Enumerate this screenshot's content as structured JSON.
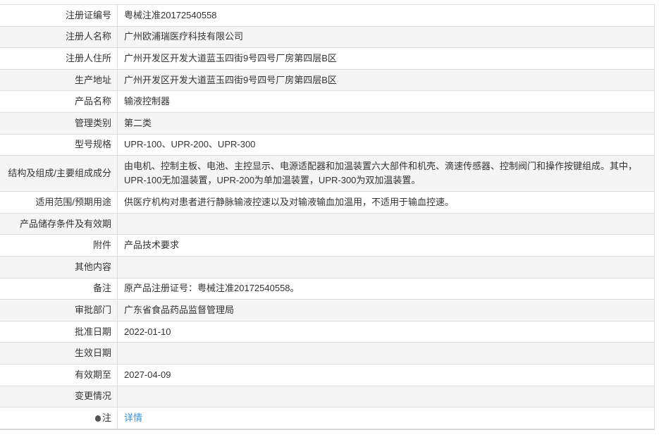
{
  "rows": [
    {
      "label": "注册证编号",
      "value": "粤械注准20172540558"
    },
    {
      "label": "注册人名称",
      "value": "广州欧浦瑞医疗科技有限公司"
    },
    {
      "label": "注册人住所",
      "value": "广州开发区开发大道蓝玉四街9号四号厂房第四层B区"
    },
    {
      "label": "生产地址",
      "value": "广州开发区开发大道蓝玉四街9号四号厂房第四层B区"
    },
    {
      "label": "产品名称",
      "value": "输液控制器"
    },
    {
      "label": "管理类别",
      "value": "第二类"
    },
    {
      "label": "型号规格",
      "value": "UPR-100、UPR-200、UPR-300"
    },
    {
      "label": "结构及组成/主要组成成分",
      "value": "由电机、控制主板、电池、主控显示、电源适配器和加温装置六大部件和机壳、滴速传感器、控制阀门和操作按键组成。其中，UPR-100无加温装置，UPR-200为单加温装置，UPR-300为双加温装置。"
    },
    {
      "label": "适用范围/预期用途",
      "value": "供医疗机构对患者进行静脉输液控速以及对输液输血加温用，不适用于输血控速。"
    },
    {
      "label": "产品储存条件及有效期",
      "value": ""
    },
    {
      "label": "附件",
      "value": "产品技术要求"
    },
    {
      "label": "其他内容",
      "value": ""
    },
    {
      "label": "备注",
      "value": "原产品注册证号：粤械注准20172540558。"
    },
    {
      "label": "审批部门",
      "value": "广东省食品药品监督管理局"
    },
    {
      "label": "批准日期",
      "value": "2022-01-10"
    },
    {
      "label": "生效日期",
      "value": ""
    },
    {
      "label": "有效期至",
      "value": "2027-04-09"
    },
    {
      "label": "变更情况",
      "value": ""
    }
  ],
  "note": {
    "label": "注",
    "link": "详情",
    "icon": "lightbulb-icon"
  }
}
